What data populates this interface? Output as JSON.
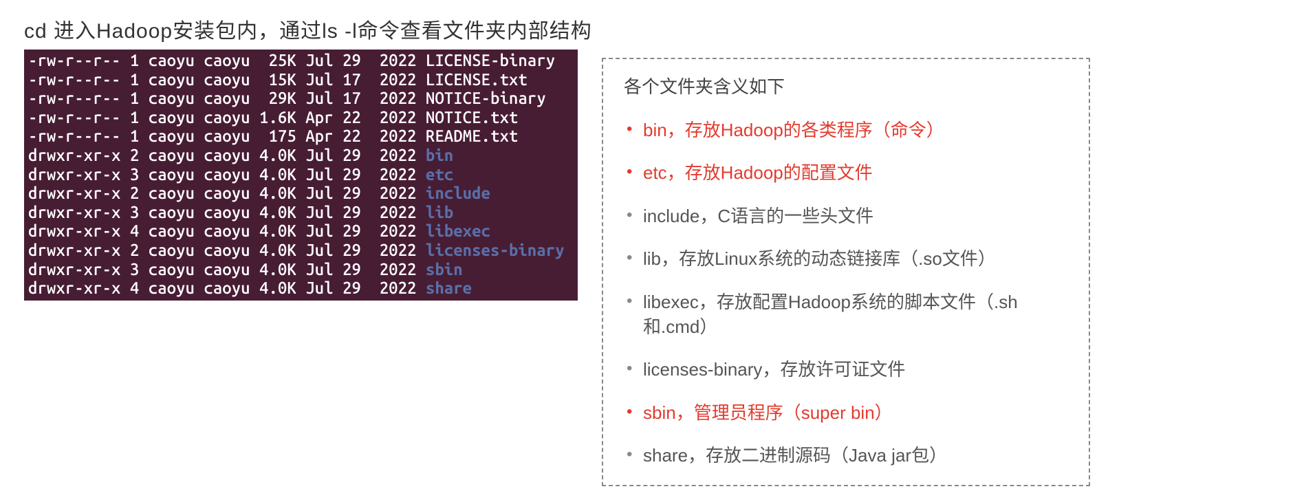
{
  "header": "cd 进入Hadoop安装包内，通过ls -l命令查看文件夹内部结构",
  "terminal": {
    "lines": [
      {
        "perm": "-rw-r--r--",
        "links": "1",
        "owner": "caoyu",
        "group": "caoyu",
        "size": " 25K",
        "date": "Jul 29  2022",
        "name": "LICENSE-binary",
        "is_dir": false
      },
      {
        "perm": "-rw-r--r--",
        "links": "1",
        "owner": "caoyu",
        "group": "caoyu",
        "size": " 15K",
        "date": "Jul 17  2022",
        "name": "LICENSE.txt",
        "is_dir": false
      },
      {
        "perm": "-rw-r--r--",
        "links": "1",
        "owner": "caoyu",
        "group": "caoyu",
        "size": " 29K",
        "date": "Jul 17  2022",
        "name": "NOTICE-binary",
        "is_dir": false
      },
      {
        "perm": "-rw-r--r--",
        "links": "1",
        "owner": "caoyu",
        "group": "caoyu",
        "size": "1.6K",
        "date": "Apr 22  2022",
        "name": "NOTICE.txt",
        "is_dir": false
      },
      {
        "perm": "-rw-r--r--",
        "links": "1",
        "owner": "caoyu",
        "group": "caoyu",
        "size": " 175",
        "date": "Apr 22  2022",
        "name": "README.txt",
        "is_dir": false
      },
      {
        "perm": "drwxr-xr-x",
        "links": "2",
        "owner": "caoyu",
        "group": "caoyu",
        "size": "4.0K",
        "date": "Jul 29  2022",
        "name": "bin",
        "is_dir": true
      },
      {
        "perm": "drwxr-xr-x",
        "links": "3",
        "owner": "caoyu",
        "group": "caoyu",
        "size": "4.0K",
        "date": "Jul 29  2022",
        "name": "etc",
        "is_dir": true
      },
      {
        "perm": "drwxr-xr-x",
        "links": "2",
        "owner": "caoyu",
        "group": "caoyu",
        "size": "4.0K",
        "date": "Jul 29  2022",
        "name": "include",
        "is_dir": true
      },
      {
        "perm": "drwxr-xr-x",
        "links": "3",
        "owner": "caoyu",
        "group": "caoyu",
        "size": "4.0K",
        "date": "Jul 29  2022",
        "name": "lib",
        "is_dir": true
      },
      {
        "perm": "drwxr-xr-x",
        "links": "4",
        "owner": "caoyu",
        "group": "caoyu",
        "size": "4.0K",
        "date": "Jul 29  2022",
        "name": "libexec",
        "is_dir": true
      },
      {
        "perm": "drwxr-xr-x",
        "links": "2",
        "owner": "caoyu",
        "group": "caoyu",
        "size": "4.0K",
        "date": "Jul 29  2022",
        "name": "licenses-binary",
        "is_dir": true
      },
      {
        "perm": "drwxr-xr-x",
        "links": "3",
        "owner": "caoyu",
        "group": "caoyu",
        "size": "4.0K",
        "date": "Jul 29  2022",
        "name": "sbin",
        "is_dir": true
      },
      {
        "perm": "drwxr-xr-x",
        "links": "4",
        "owner": "caoyu",
        "group": "caoyu",
        "size": "4.0K",
        "date": "Jul 29  2022",
        "name": "share",
        "is_dir": true
      }
    ]
  },
  "description": {
    "title": "各个文件夹含义如下",
    "items": [
      {
        "text": "bin，存放Hadoop的各类程序（命令）",
        "highlight": true
      },
      {
        "text": "etc，存放Hadoop的配置文件",
        "highlight": true
      },
      {
        "text": "include，C语言的一些头文件",
        "highlight": false
      },
      {
        "text": "lib，存放Linux系统的动态链接库（.so文件）",
        "highlight": false
      },
      {
        "text": "libexec，存放配置Hadoop系统的脚本文件（.sh和.cmd）",
        "highlight": false
      },
      {
        "text": "licenses-binary，存放许可证文件",
        "highlight": false
      },
      {
        "text": "sbin，管理员程序（super bin）",
        "highlight": true
      },
      {
        "text": "share，存放二进制源码（Java jar包）",
        "highlight": false
      }
    ]
  }
}
